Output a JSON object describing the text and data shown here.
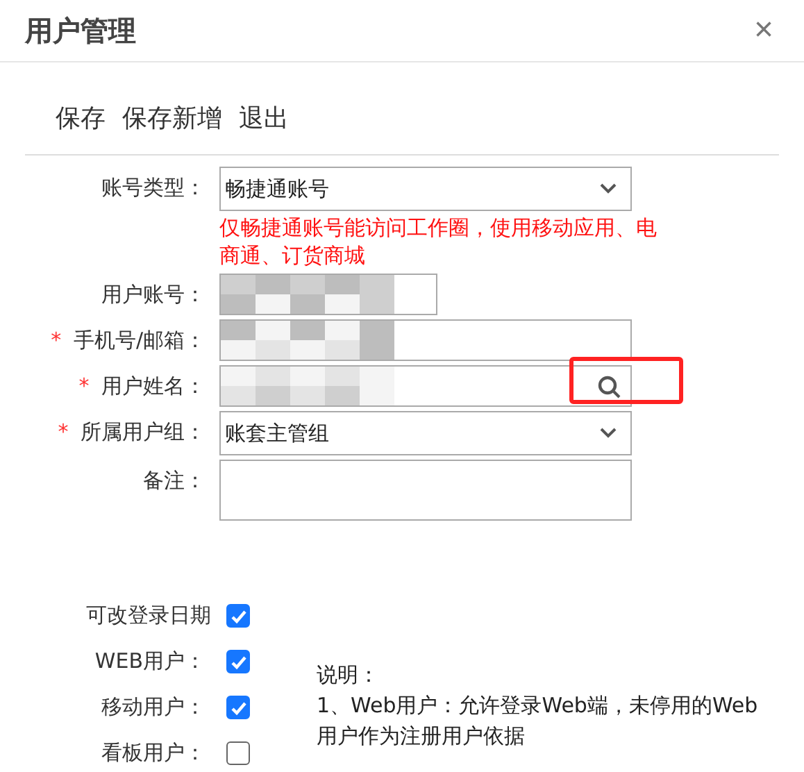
{
  "window": {
    "title": "用户管理",
    "close": "×"
  },
  "toolbar": [
    "保存",
    "保存新增",
    "退出"
  ],
  "fields": [
    {
      "kind": "select",
      "label": "账号类型：",
      "value": "畅捷通账号",
      "hint": "仅畅捷通账号能访问工作圈，使用移动应用、电商通、订货商城"
    },
    {
      "kind": "short",
      "label": "用户账号：",
      "redacted": true
    },
    {
      "kind": "input",
      "label": "手机号/邮箱：",
      "required_mark": "*",
      "redacted": true
    },
    {
      "kind": "search",
      "label": "用户姓名：",
      "required_mark": "*",
      "redacted": true,
      "highlighted": true
    },
    {
      "kind": "select",
      "label": "所属用户组：",
      "required_mark": "*",
      "value": "账套主管组"
    },
    {
      "kind": "textarea",
      "label": "备注："
    }
  ],
  "options": [
    {
      "label": "可改登录日期",
      "checked": true
    },
    {
      "label": "WEB用户：",
      "checked": true
    },
    {
      "label": "移动用户：",
      "checked": true
    },
    {
      "label": "看板用户：",
      "checked": false
    }
  ],
  "note": {
    "heading": "说明：",
    "lines": [
      "1、Web用户：允许登录Web端，未停用的Web用户作为注册用户依据"
    ]
  }
}
